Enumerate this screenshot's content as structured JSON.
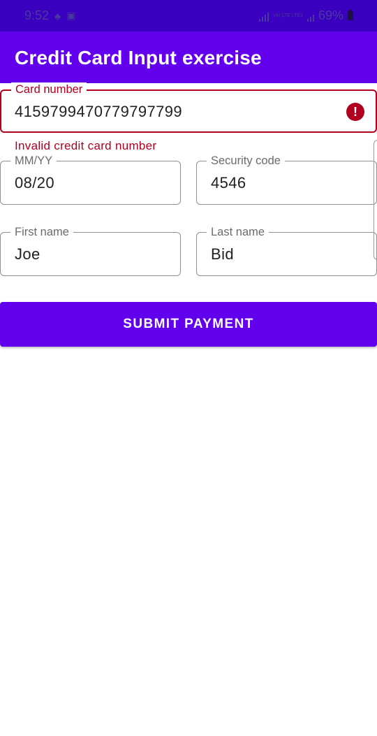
{
  "status_bar": {
    "time": "9:52",
    "battery": "69%",
    "network_tag": "Vo) LTE LTE1"
  },
  "app_bar": {
    "title": "Credit Card Input exercise"
  },
  "form": {
    "card_number": {
      "label": "Card number",
      "value": "4159799470779797799",
      "error": "Invalid credit card number"
    },
    "expiry": {
      "label": "MM/YY",
      "value": "08/20"
    },
    "security_code": {
      "label": "Security code",
      "value": "4546"
    },
    "first_name": {
      "label": "First name",
      "value": "Joe"
    },
    "last_name": {
      "label": "Last name",
      "value": "Bid"
    }
  },
  "submit_label": "SUBMIT PAYMENT",
  "colors": {
    "primary": "#6200ee",
    "status_bar": "#3b00bf",
    "error": "#b00020"
  }
}
